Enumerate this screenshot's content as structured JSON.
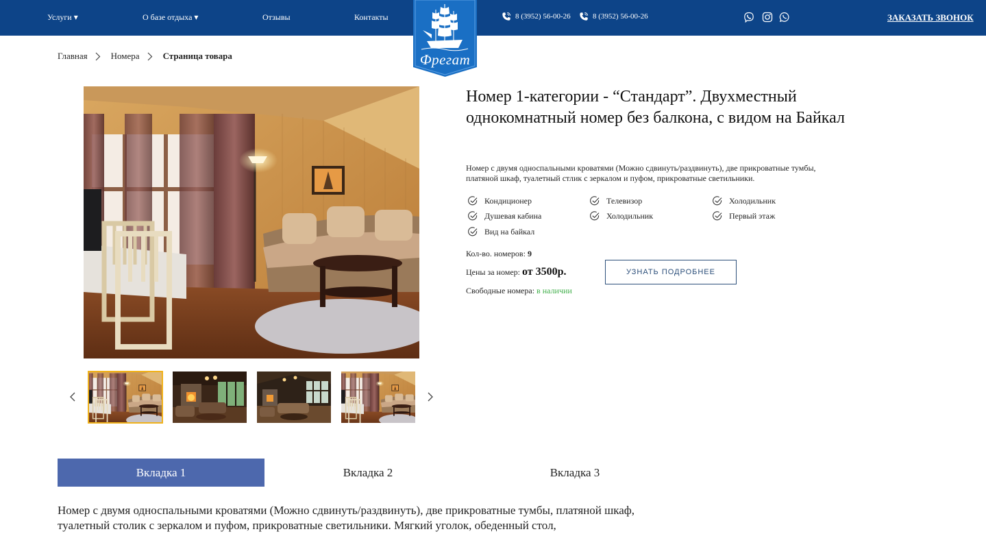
{
  "header": {
    "nav": [
      {
        "label": "Услуги ▾"
      },
      {
        "label": "О базе отдыха ▾"
      },
      {
        "label": "Отзывы"
      },
      {
        "label": "Контакты"
      }
    ],
    "phones": [
      "8 (3952) 56-00-26",
      "8 (3952) 56-00-26"
    ],
    "social_icons": [
      "viber-icon",
      "instagram-icon",
      "whatsapp-icon"
    ],
    "callback_label": "ЗАКАЗАТЬ ЗВОНОК",
    "logo_text": "Фрегат",
    "colors": {
      "bar": "#0d4488",
      "logo_bg": "#1a6fc4"
    }
  },
  "breadcrumb": {
    "items": [
      "Главная",
      "Номера"
    ],
    "current": "Страница товара"
  },
  "gallery": {
    "thumbnails": [
      "room-thumb",
      "lounge-thumb",
      "hall-thumb",
      "room-thumb"
    ],
    "active_index": 0,
    "prev_icon": "chevron-left-icon",
    "next_icon": "chevron-right-icon"
  },
  "product": {
    "title": "Номер 1-категории - “Стандарт”. Двухместный однокомнатный номер без балкона, с видом на Байкал",
    "description": "Номер с двумя односпальными кроватями (Можно сдвинуть/раздвинуть), две прикроватные тумбы, платяной шкаф, туалетный стлик с зеркалом и пуфом, прикроватные светильники.",
    "features": [
      "Кондиционер",
      "Телевизор",
      "Холодильник",
      "Душевая кабина",
      "Холодильник",
      "Первый этаж",
      "Вид на байкал"
    ],
    "count_label": "Кол-во. номеров:",
    "count_value": "9",
    "price_label": "Цены за номер:",
    "price_value": "от 3500р.",
    "free_label": "Свободные номера:",
    "free_value": "в наличии",
    "more_button": "УЗНАТЬ ПОДРОБНЕЕ",
    "colors": {
      "available": "#3fae49",
      "button_border": "#2c4f7a"
    }
  },
  "tabs": {
    "items": [
      "Вкладка 1",
      "Вкладка 2",
      "Вкладка 3"
    ],
    "active_index": 0,
    "active_color": "#4d68ad",
    "content": "Номер с двумя односпальными кроватями (Можно сдвинуть/раздвинуть), две прикроватные тумбы, платяной шкаф, туалетный столик с зеркалом и пуфом, прикроватные светильники. Мягкий уголок, обеденный стол,"
  }
}
